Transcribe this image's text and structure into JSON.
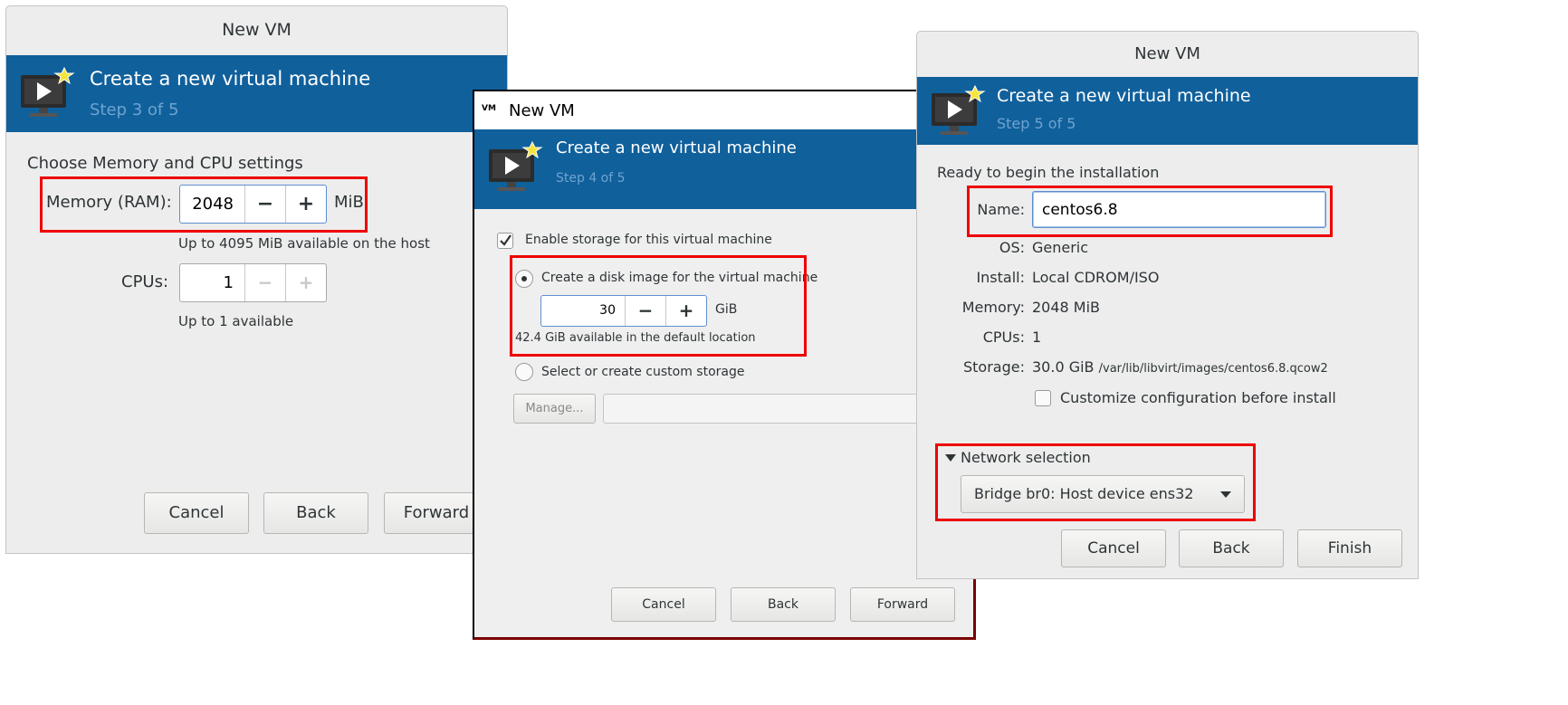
{
  "dialog1": {
    "window_title": "New VM",
    "banner_title": "Create a new virtual machine",
    "banner_step": "Step 3 of 5",
    "heading": "Choose Memory and CPU settings",
    "memory_label": "Memory (RAM):",
    "memory_value": "2048",
    "memory_unit": "MiB",
    "memory_hint": "Up to 4095 MiB available on the host",
    "cpus_label": "CPUs:",
    "cpus_value": "1",
    "cpus_hint": "Up to 1 available",
    "cancel_label": "Cancel",
    "back_label": "Back",
    "forward_label": "Forward"
  },
  "dialog2": {
    "window_title": "New VM",
    "app_badge": "VM",
    "banner_title": "Create a new virtual machine",
    "banner_step": "Step 4 of 5",
    "enable_storage_label": "Enable storage for this virtual machine",
    "create_disk_label": "Create a disk image for the virtual machine",
    "disk_value": "30",
    "disk_unit": "GiB",
    "disk_hint": "42.4 GiB available in the default location",
    "custom_storage_label": "Select or create custom storage",
    "manage_label": "Manage...",
    "storage_path_value": "",
    "cancel_label": "Cancel",
    "back_label": "Back",
    "forward_label": "Forward"
  },
  "dialog3": {
    "window_title": "New VM",
    "banner_title": "Create a new virtual machine",
    "banner_step": "Step 5 of 5",
    "heading": "Ready to begin the installation",
    "name_label": "Name:",
    "name_value": "centos6.8",
    "os_label": "OS:",
    "os_value": "Generic",
    "install_label": "Install:",
    "install_value": "Local CDROM/ISO",
    "memory_label": "Memory:",
    "memory_value": "2048 MiB",
    "cpus_label": "CPUs:",
    "cpus_value": "1",
    "storage_label": "Storage:",
    "storage_value": "30.0 GiB",
    "storage_path": "/var/lib/libvirt/images/centos6.8.qcow2",
    "customize_label": "Customize configuration before install",
    "network_label": "Network selection",
    "network_value": "Bridge br0: Host device ens32",
    "cancel_label": "Cancel",
    "back_label": "Back",
    "finish_label": "Finish"
  },
  "colors": {
    "banner": "#10609c",
    "highlight": "#ee0000",
    "dialog_bg": "#ededed"
  }
}
